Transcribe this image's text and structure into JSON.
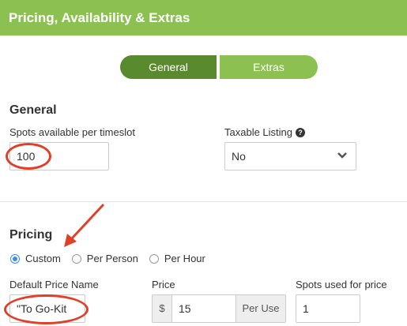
{
  "header": {
    "title": "Pricing, Availability & Extras"
  },
  "tabs": [
    {
      "label": "General"
    },
    {
      "label": "Extras"
    }
  ],
  "general": {
    "title": "General",
    "spots_label": "Spots available per timeslot",
    "spots_value": "100",
    "taxable_label": "Taxable Listing",
    "taxable_value": "No"
  },
  "pricing": {
    "title": "Pricing",
    "options": [
      {
        "label": "Custom",
        "checked": true
      },
      {
        "label": "Per Person",
        "checked": false
      },
      {
        "label": "Per Hour",
        "checked": false
      }
    ],
    "default_price_name_label": "Default Price Name",
    "default_price_name_value": "\"To Go-Kit",
    "price_label": "Price",
    "currency_symbol": "$",
    "price_value": "15",
    "price_unit": "Per Use",
    "spots_used_label": "Spots used for price",
    "spots_used_value": "1"
  },
  "colors": {
    "header_green": "#8cc152",
    "tab_active": "#5a8a2e",
    "annotation_red": "#e0402a",
    "radio_blue": "#3b8ede"
  }
}
